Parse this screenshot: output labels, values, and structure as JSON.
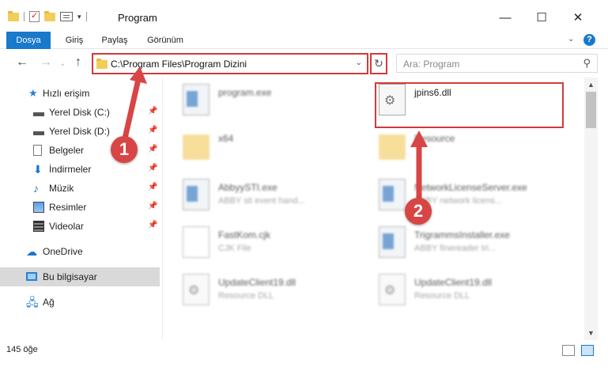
{
  "window": {
    "title": "Program",
    "minimize": "—",
    "maximize": "☐",
    "close": "✕"
  },
  "ribbon": {
    "tabs": [
      "Dosya",
      "Giriş",
      "Paylaş",
      "Görünüm"
    ],
    "caret": "⌄",
    "help": "?"
  },
  "nav": {
    "back": "←",
    "forward": "→",
    "up": "↑",
    "address": "C:\\Program Files\\Program Dizini",
    "address_dropdown": "⌄",
    "refresh": "↻",
    "search_placeholder": "Ara: Program",
    "search_icon": "⚲"
  },
  "sidebar": {
    "quick_access": "Hızlı erişim",
    "items": [
      {
        "label": "Yerel Disk (C:)",
        "icon": "disk-icon",
        "pinned": true
      },
      {
        "label": "Yerel Disk (D:)",
        "icon": "disk-icon",
        "pinned": true
      },
      {
        "label": "Belgeler",
        "icon": "documents-icon",
        "pinned": true
      },
      {
        "label": "İndirmeler",
        "icon": "download-icon",
        "pinned": true
      },
      {
        "label": "Müzik",
        "icon": "music-icon",
        "pinned": true
      },
      {
        "label": "Resimler",
        "icon": "pictures-icon",
        "pinned": true
      },
      {
        "label": "Videolar",
        "icon": "videos-icon",
        "pinned": true
      }
    ],
    "onedrive": "OneDrive",
    "this_pc": "Bu bilgisayar",
    "network": "Ağ",
    "pin_glyph": "📌"
  },
  "files": [
    {
      "name": "program.exe",
      "sub": "",
      "icon": "exe-icon",
      "blurred": true
    },
    {
      "name": "jpins6.dll",
      "sub": "",
      "icon": "dll-icon",
      "blurred": false
    },
    {
      "name": "x64",
      "sub": "",
      "icon": "folder-icon",
      "blurred": true
    },
    {
      "name": "Resource",
      "sub": "",
      "icon": "folder-icon",
      "blurred": true
    },
    {
      "name": "AbbyySTI.exe",
      "sub": "ABBY sti event hand...",
      "icon": "exe-icon",
      "blurred": true
    },
    {
      "name": "NetworkLicenseServer.exe",
      "sub": "ABBY network licens...",
      "icon": "exe-icon",
      "blurred": true
    },
    {
      "name": "FastKom.cjk",
      "sub": "CJK File",
      "icon": "file-icon",
      "blurred": true
    },
    {
      "name": "TrigrammsInstaller.exe",
      "sub": "ABBY finereader tri...",
      "icon": "exe-icon",
      "blurred": true
    },
    {
      "name": "UpdateClient19.dll",
      "sub": "Resource DLL",
      "icon": "dll-icon",
      "blurred": true
    },
    {
      "name": "UpdateClient19.dll",
      "sub": "Resource DLL",
      "icon": "dll-icon",
      "blurred": true
    }
  ],
  "status": {
    "count": "145 öğe"
  },
  "annotations": {
    "step1": "1",
    "step2": "2",
    "color": "#d84545"
  },
  "colors": {
    "accent": "#1979ca",
    "highlight": "#d23a3a",
    "selected_bg": "#d9d9d9"
  }
}
